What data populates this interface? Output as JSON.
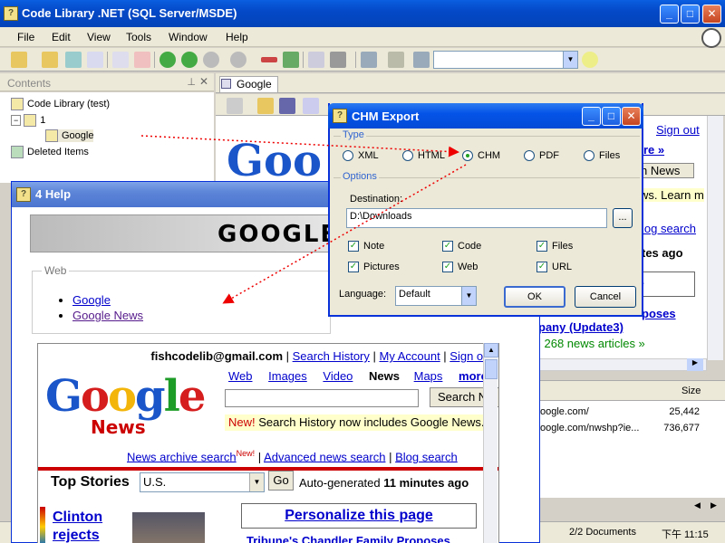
{
  "main": {
    "title": "Code Library .NET (SQL Server/MSDE)",
    "menu": [
      "File",
      "Edit",
      "View",
      "Tools",
      "Window",
      "Help"
    ]
  },
  "contents": {
    "header": "Contents",
    "tree": [
      "Code Library (test)",
      "1",
      "Google",
      "Deleted Items"
    ]
  },
  "doc_tab": "Google",
  "bg_fragments": {
    "signout": "Sign out",
    "more": "ore »",
    "news": "h News",
    "learn": "ws.  Learn m",
    "blog": "log search",
    "minutes": "tes ago",
    "e": "e",
    "update": "pany (Update3)",
    "poses": "poses",
    "news_articles": "l 268 news articles »"
  },
  "file_list": {
    "size_header": "Size",
    "rows": [
      {
        "url": "oogle.com/",
        "size": "25,442"
      },
      {
        "url": "oogle.com/nwshp?ie...",
        "size": "736,677"
      }
    ]
  },
  "status": {
    "docs": "2/2 Documents",
    "time": "下午 11:15"
  },
  "help_window": {
    "title": "4 Help",
    "banner": "GOOGLE",
    "web_legend": "Web",
    "links": [
      "Google",
      "Google News"
    ]
  },
  "google_news": {
    "top": {
      "email": "fishcodelib@gmail.com",
      "search_history": "Search History",
      "my_account": "My Account",
      "sign_out": "Sign out"
    },
    "nav": [
      "Web",
      "Images",
      "Video",
      "News",
      "Maps",
      "more"
    ],
    "logo": "Google",
    "logo_sub": "News",
    "search_btn": "Search N",
    "new_label": "New!",
    "new_text": " Search History now includes Google News.",
    "links": {
      "archive": "News archive search",
      "new": "New!",
      "advanced": "Advanced news search",
      "blog": "Blog search"
    },
    "top_stories": "Top Stories",
    "region": "U.S.",
    "go": "Go",
    "auto_prefix": "Auto-generated ",
    "auto_bold": "11 minutes ago",
    "clinton": "Clinton rejects",
    "personalize": "Personalize this page",
    "tribune": "Tribune's Chandler Family Proposes"
  },
  "dialog": {
    "title": "CHM Export",
    "type_label": "Type",
    "types": [
      "XML",
      "HTML",
      "CHM",
      "PDF",
      "Files"
    ],
    "selected_type": "CHM",
    "options_label": "Options",
    "dest_label": "Destination:",
    "dest_value": "D:\\Downloads",
    "browse": "...",
    "checks": [
      "Note",
      "Code",
      "Files",
      "Pictures",
      "Web",
      "URL"
    ],
    "language_label": "Language:",
    "language_value": "Default",
    "ok": "OK",
    "cancel": "Cancel"
  }
}
